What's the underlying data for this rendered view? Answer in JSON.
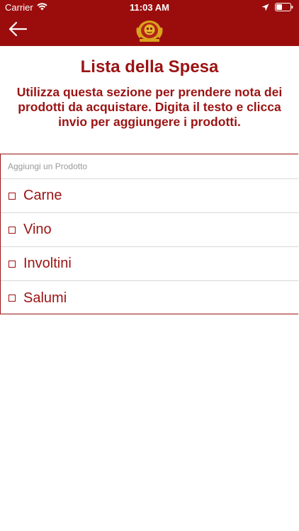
{
  "status_bar": {
    "carrier": "Carrier",
    "time": "11:03 AM"
  },
  "nav": {
    "back_icon": "arrow-left-icon",
    "logo": "crest-logo"
  },
  "page": {
    "title": "Lista della Spesa",
    "description": "Utilizza questa sezione per prendere nota dei prodotti da acquistare. Digita il testo e clicca invio per aggiungere i prodotti."
  },
  "shopping_list": {
    "input_placeholder": "Aggiungi un Prodotto",
    "input_value": "",
    "items": [
      {
        "label": "Carne",
        "checked": false
      },
      {
        "label": "Vino",
        "checked": false
      },
      {
        "label": "Involtini",
        "checked": false
      },
      {
        "label": "Salumi",
        "checked": false
      }
    ]
  },
  "colors": {
    "brand": "#9b0d0d",
    "text_accent": "#9b1313"
  }
}
